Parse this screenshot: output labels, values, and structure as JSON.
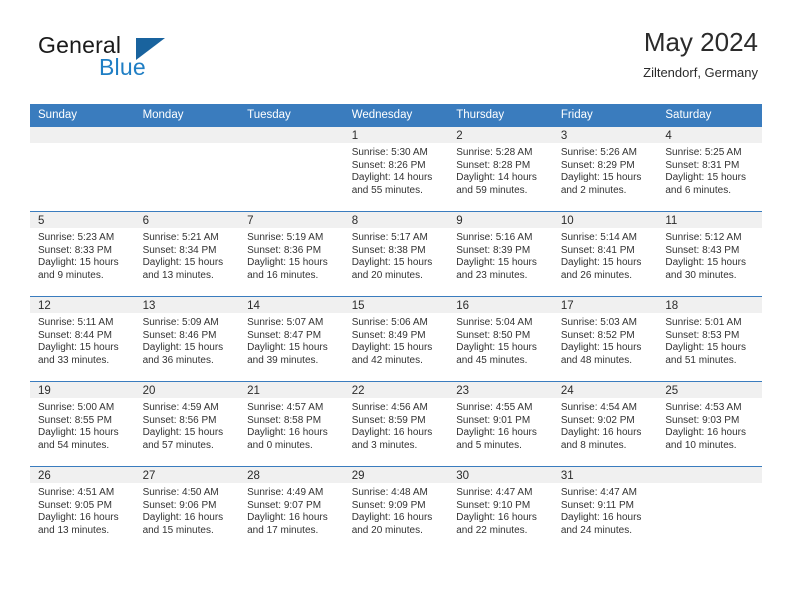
{
  "brand": {
    "name_primary": "General",
    "name_secondary": "Blue",
    "triangle_icon": "triangle-logo-icon"
  },
  "header": {
    "title": "May 2024",
    "subtitle": "Ziltendorf, Germany"
  },
  "calendar": {
    "weekday_headers": [
      "Sunday",
      "Monday",
      "Tuesday",
      "Wednesday",
      "Thursday",
      "Friday",
      "Saturday"
    ],
    "accent_color": "#3a7cbe",
    "daynum_strip_color": "#f0f0f0",
    "weeks": [
      [
        {
          "day": ""
        },
        {
          "day": ""
        },
        {
          "day": ""
        },
        {
          "day": "1",
          "sunrise": "Sunrise: 5:30 AM",
          "sunset": "Sunset: 8:26 PM",
          "daylight": "Daylight: 14 hours and 55 minutes."
        },
        {
          "day": "2",
          "sunrise": "Sunrise: 5:28 AM",
          "sunset": "Sunset: 8:28 PM",
          "daylight": "Daylight: 14 hours and 59 minutes."
        },
        {
          "day": "3",
          "sunrise": "Sunrise: 5:26 AM",
          "sunset": "Sunset: 8:29 PM",
          "daylight": "Daylight: 15 hours and 2 minutes."
        },
        {
          "day": "4",
          "sunrise": "Sunrise: 5:25 AM",
          "sunset": "Sunset: 8:31 PM",
          "daylight": "Daylight: 15 hours and 6 minutes."
        }
      ],
      [
        {
          "day": "5",
          "sunrise": "Sunrise: 5:23 AM",
          "sunset": "Sunset: 8:33 PM",
          "daylight": "Daylight: 15 hours and 9 minutes."
        },
        {
          "day": "6",
          "sunrise": "Sunrise: 5:21 AM",
          "sunset": "Sunset: 8:34 PM",
          "daylight": "Daylight: 15 hours and 13 minutes."
        },
        {
          "day": "7",
          "sunrise": "Sunrise: 5:19 AM",
          "sunset": "Sunset: 8:36 PM",
          "daylight": "Daylight: 15 hours and 16 minutes."
        },
        {
          "day": "8",
          "sunrise": "Sunrise: 5:17 AM",
          "sunset": "Sunset: 8:38 PM",
          "daylight": "Daylight: 15 hours and 20 minutes."
        },
        {
          "day": "9",
          "sunrise": "Sunrise: 5:16 AM",
          "sunset": "Sunset: 8:39 PM",
          "daylight": "Daylight: 15 hours and 23 minutes."
        },
        {
          "day": "10",
          "sunrise": "Sunrise: 5:14 AM",
          "sunset": "Sunset: 8:41 PM",
          "daylight": "Daylight: 15 hours and 26 minutes."
        },
        {
          "day": "11",
          "sunrise": "Sunrise: 5:12 AM",
          "sunset": "Sunset: 8:43 PM",
          "daylight": "Daylight: 15 hours and 30 minutes."
        }
      ],
      [
        {
          "day": "12",
          "sunrise": "Sunrise: 5:11 AM",
          "sunset": "Sunset: 8:44 PM",
          "daylight": "Daylight: 15 hours and 33 minutes."
        },
        {
          "day": "13",
          "sunrise": "Sunrise: 5:09 AM",
          "sunset": "Sunset: 8:46 PM",
          "daylight": "Daylight: 15 hours and 36 minutes."
        },
        {
          "day": "14",
          "sunrise": "Sunrise: 5:07 AM",
          "sunset": "Sunset: 8:47 PM",
          "daylight": "Daylight: 15 hours and 39 minutes."
        },
        {
          "day": "15",
          "sunrise": "Sunrise: 5:06 AM",
          "sunset": "Sunset: 8:49 PM",
          "daylight": "Daylight: 15 hours and 42 minutes."
        },
        {
          "day": "16",
          "sunrise": "Sunrise: 5:04 AM",
          "sunset": "Sunset: 8:50 PM",
          "daylight": "Daylight: 15 hours and 45 minutes."
        },
        {
          "day": "17",
          "sunrise": "Sunrise: 5:03 AM",
          "sunset": "Sunset: 8:52 PM",
          "daylight": "Daylight: 15 hours and 48 minutes."
        },
        {
          "day": "18",
          "sunrise": "Sunrise: 5:01 AM",
          "sunset": "Sunset: 8:53 PM",
          "daylight": "Daylight: 15 hours and 51 minutes."
        }
      ],
      [
        {
          "day": "19",
          "sunrise": "Sunrise: 5:00 AM",
          "sunset": "Sunset: 8:55 PM",
          "daylight": "Daylight: 15 hours and 54 minutes."
        },
        {
          "day": "20",
          "sunrise": "Sunrise: 4:59 AM",
          "sunset": "Sunset: 8:56 PM",
          "daylight": "Daylight: 15 hours and 57 minutes."
        },
        {
          "day": "21",
          "sunrise": "Sunrise: 4:57 AM",
          "sunset": "Sunset: 8:58 PM",
          "daylight": "Daylight: 16 hours and 0 minutes."
        },
        {
          "day": "22",
          "sunrise": "Sunrise: 4:56 AM",
          "sunset": "Sunset: 8:59 PM",
          "daylight": "Daylight: 16 hours and 3 minutes."
        },
        {
          "day": "23",
          "sunrise": "Sunrise: 4:55 AM",
          "sunset": "Sunset: 9:01 PM",
          "daylight": "Daylight: 16 hours and 5 minutes."
        },
        {
          "day": "24",
          "sunrise": "Sunrise: 4:54 AM",
          "sunset": "Sunset: 9:02 PM",
          "daylight": "Daylight: 16 hours and 8 minutes."
        },
        {
          "day": "25",
          "sunrise": "Sunrise: 4:53 AM",
          "sunset": "Sunset: 9:03 PM",
          "daylight": "Daylight: 16 hours and 10 minutes."
        }
      ],
      [
        {
          "day": "26",
          "sunrise": "Sunrise: 4:51 AM",
          "sunset": "Sunset: 9:05 PM",
          "daylight": "Daylight: 16 hours and 13 minutes."
        },
        {
          "day": "27",
          "sunrise": "Sunrise: 4:50 AM",
          "sunset": "Sunset: 9:06 PM",
          "daylight": "Daylight: 16 hours and 15 minutes."
        },
        {
          "day": "28",
          "sunrise": "Sunrise: 4:49 AM",
          "sunset": "Sunset: 9:07 PM",
          "daylight": "Daylight: 16 hours and 17 minutes."
        },
        {
          "day": "29",
          "sunrise": "Sunrise: 4:48 AM",
          "sunset": "Sunset: 9:09 PM",
          "daylight": "Daylight: 16 hours and 20 minutes."
        },
        {
          "day": "30",
          "sunrise": "Sunrise: 4:47 AM",
          "sunset": "Sunset: 9:10 PM",
          "daylight": "Daylight: 16 hours and 22 minutes."
        },
        {
          "day": "31",
          "sunrise": "Sunrise: 4:47 AM",
          "sunset": "Sunset: 9:11 PM",
          "daylight": "Daylight: 16 hours and 24 minutes."
        },
        {
          "day": ""
        }
      ]
    ]
  }
}
